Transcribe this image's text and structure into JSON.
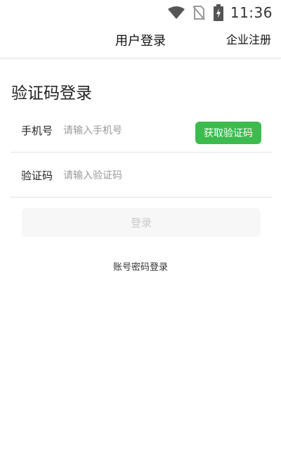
{
  "status_bar": {
    "time": "11:36",
    "icons": [
      "wifi-icon",
      "no-sim-icon",
      "battery-charging-icon"
    ]
  },
  "header": {
    "title": "用户登录",
    "register_label": "企业注册"
  },
  "main": {
    "section_title": "验证码登录",
    "phone": {
      "label": "手机号",
      "placeholder": "请输入手机号",
      "value": ""
    },
    "sms_button_label": "获取验证码",
    "code": {
      "label": "验证码",
      "placeholder": "请输入验证码",
      "value": ""
    },
    "login_label": "登录",
    "password_login_label": "账号密码登录"
  },
  "colors": {
    "accent": "#3dbb4e",
    "login_disabled_bg": "#f7f7f7",
    "login_disabled_text": "#c8c8c8",
    "divider": "#e3e3e3"
  }
}
